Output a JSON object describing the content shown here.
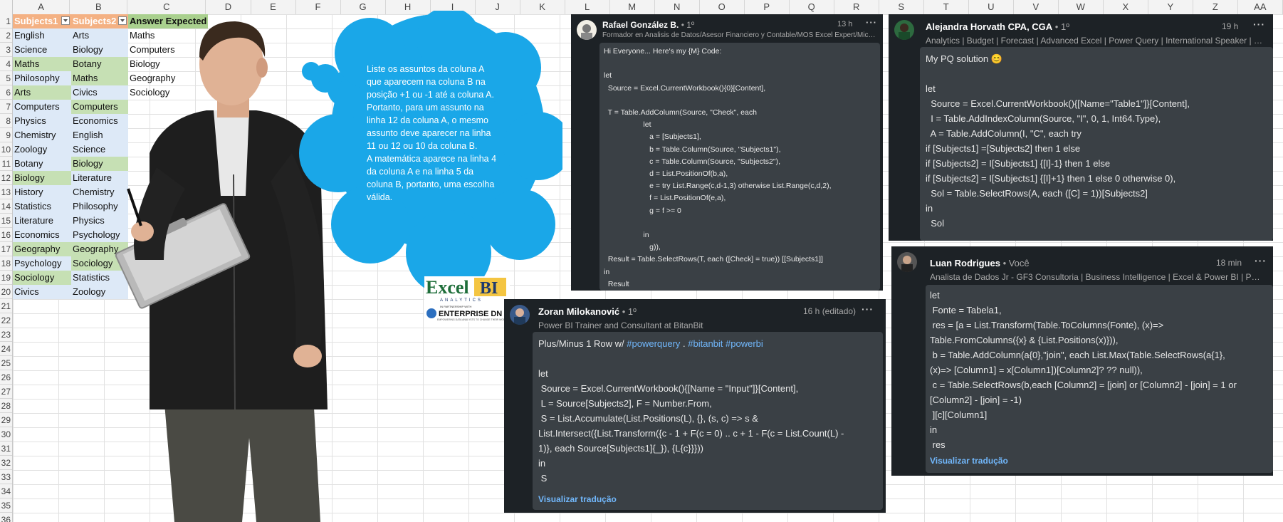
{
  "columns": [
    "A",
    "B",
    "C",
    "D",
    "E",
    "F",
    "G",
    "H",
    "I",
    "J",
    "K",
    "L",
    "M",
    "N",
    "O",
    "P",
    "Q",
    "R",
    "S",
    "T",
    "U",
    "V",
    "W",
    "X",
    "Y",
    "Z",
    "AA"
  ],
  "rows": [
    "1",
    "2",
    "3",
    "4",
    "5",
    "6",
    "7",
    "8",
    "9",
    "10",
    "11",
    "12",
    "13",
    "14",
    "15",
    "16",
    "17",
    "18",
    "19",
    "20",
    "21",
    "22",
    "23",
    "24",
    "25",
    "26",
    "27",
    "28",
    "29",
    "30",
    "31",
    "32",
    "33",
    "34",
    "35",
    "36"
  ],
  "table": {
    "headers": {
      "a": "Subjects1",
      "b": "Subjects2",
      "c": "Answer Expected"
    },
    "colA": [
      "English",
      "Science",
      "Maths",
      "Philosophy",
      "Arts",
      "Computers",
      "Physics",
      "Chemistry",
      "Zoology",
      "Botany",
      "Biology",
      "History",
      "Statistics",
      "Literature",
      "Economics",
      "Geography",
      "Psychology",
      "Sociology",
      "Civics"
    ],
    "colB": [
      "Arts",
      "Biology",
      "Botany",
      "Maths",
      "Civics",
      "Computers",
      "Economics",
      "English",
      "Science",
      "Biology",
      "Literature",
      "Chemistry",
      "Philosophy",
      "Physics",
      "Psychology",
      "Geography",
      "Sociology",
      "Statistics",
      "Zoology"
    ],
    "colC": [
      "Maths",
      "Computers",
      "Biology",
      "Geography",
      "Sociology"
    ]
  },
  "bubble": {
    "p1": "Liste os assuntos da coluna A que aparecem na coluna B na posição +1 ou -1 até a coluna A.",
    "p2": "Portanto, para um assunto na linha 12 da coluna A, o mesmo assunto deve aparecer na linha 11 ou 12 ou 10 da coluna B.",
    "p3": "A matemática aparece na linha 4 da coluna A e na linha 5 da coluna B, portanto, uma escolha válida."
  },
  "logo": {
    "brand": "Excel BI",
    "sub": "ANALYTICS",
    "partner": "IN PARTNERSHIP WITH",
    "enterprise": "ENTERPRISE DN",
    "tagline": "EMPOWERING DATA ANALYSTS TO CHANGE THEIR WORLD"
  },
  "posts": {
    "rafael": {
      "name": "Rafael González B.",
      "degree": " • 1º",
      "time": "13 h",
      "headline": "Formador en Analisis de Datos/Asesor Financiero y Contable/MOS Excel Expert/Micros...",
      "lines": [
        "Hi Everyone... Here's my {M} Code:",
        "",
        "let",
        "  Source = Excel.CurrentWorkbook(){0}[Content],",
        "",
        "  T = Table.AddColumn(Source, \"Check\", each",
        "                   let",
        "                      a = [Subjects1],",
        "                      b = Table.Column(Source, \"Subjects1\"),",
        "                      c = Table.Column(Source, \"Subjects2\"),",
        "                      d = List.PositionOf(b,a),",
        "                      e = try List.Range(c,d-1,3) otherwise List.Range(c,d,2),",
        "                      f = List.PositionOf(e,a),",
        "                      g = f >= 0",
        "",
        "                   in",
        "                      g)),",
        "  Result = Table.SelectRows(T, each ([Check] = true)) [[Subjects1]]",
        "in",
        "  Result"
      ]
    },
    "alejandra": {
      "name": "Alejandra Horvath CPA, CGA",
      "degree": " • 1º",
      "time": "19 h",
      "headline": "Analytics | Budget | Forecast | Advanced Excel | Power Query | International Speaker | C...",
      "lines": [
        "My PQ solution 😊",
        "",
        "let",
        "  Source = Excel.CurrentWorkbook(){[Name=\"Table1\"]}[Content],",
        "  I = Table.AddIndexColumn(Source, \"I\", 0, 1, Int64.Type),",
        "  A = Table.AddColumn(I, \"C\", each try",
        "if [Subjects1] =[Subjects2] then 1 else",
        "if [Subjects2] = I[Subjects1] {[I]-1} then 1 else",
        "if [Subjects2] = I[Subjects1] {[I]+1} then 1 else 0 otherwise 0),",
        "  Sol = Table.SelectRows(A, each ([C] = 1))[Subjects2]",
        "in",
        "  Sol"
      ]
    },
    "zoran": {
      "name": "Zoran Milokanović",
      "degree": " • 1º",
      "time": "16 h (editado)",
      "headline": "Power BI Trainer and Consultant at BitanBit",
      "intro": "Plus/Minus 1 Row w/ ",
      "tag1": "#powerquery",
      "sep": " . ",
      "tag2": "#bitanbit",
      "tag3": "#powerbi",
      "lines": [
        "let",
        " Source = Excel.CurrentWorkbook(){[Name = \"Input\"]}[Content],",
        " L = Source[Subjects2], F = Number.From,",
        " S = List.Accumulate(List.Positions(L), {}, (s, c) => s &",
        "List.Intersect({List.Transform({c - 1 + F(c = 0) .. c + 1 - F(c = List.Count(L) -",
        "1)}, each Source[Subjects1]{_}), {L{c}}}))",
        "in",
        " S"
      ],
      "translate": "Visualizar tradução"
    },
    "luan": {
      "name": "Luan Rodrigues",
      "degree": " • Você",
      "time": "18 min",
      "headline": "Analista de Dados Jr - GF3 Consultoria | Business Intelligence | Excel & Power BI | Powe...",
      "lines": [
        "let",
        " Fonte = Tabela1,",
        " res = [a = List.Transform(Table.ToColumns(Fonte), (x)=>",
        "Table.FromColumns({x} & {List.Positions(x)})),",
        " b = Table.AddColumn(a{0},\"join\", each List.Max(Table.SelectRows(a{1},",
        "(x)=> [Column1] = x[Column1])[Column2]? ?? null)),",
        " c = Table.SelectRows(b,each [Column2] = [join] or [Column2] - [join] = 1 or",
        "[Column2] - [join] = -1)",
        " ][c][Column1]",
        "in",
        " res"
      ],
      "translate": "Visualizar tradução"
    }
  }
}
